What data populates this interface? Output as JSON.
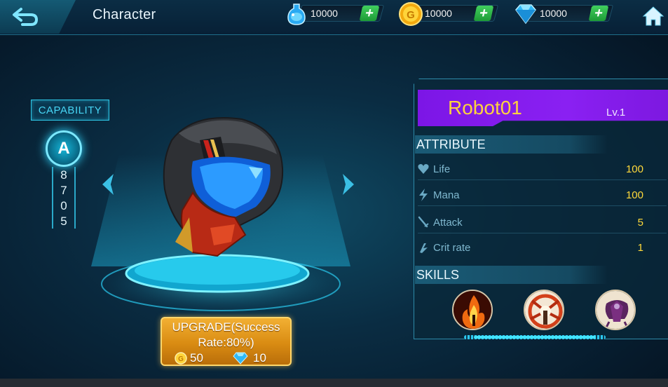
{
  "header": {
    "title": "Character"
  },
  "resources": [
    {
      "name": "mana-potion",
      "value": "10000"
    },
    {
      "name": "gold",
      "value": "10000"
    },
    {
      "name": "diamond",
      "value": "10000"
    }
  ],
  "capability": {
    "label": "CAPABILITY",
    "grade": "A",
    "digits": [
      "8",
      "7",
      "0",
      "5"
    ]
  },
  "upgrade": {
    "label": "UPGRADE(Success Rate:80%)",
    "gold_cost": "50",
    "diamond_cost": "10"
  },
  "character": {
    "name": "Robot01",
    "level": "Lv.1"
  },
  "attributes": {
    "heading": "ATTRIBUTE",
    "items": [
      {
        "label": "Life",
        "value": "100",
        "icon": "heart-icon"
      },
      {
        "label": "Mana",
        "value": "100",
        "icon": "lightning-icon"
      },
      {
        "label": "Attack",
        "value": "5",
        "icon": "sword-icon"
      },
      {
        "label": "Crit rate",
        "value": "1",
        "icon": "crit-icon"
      }
    ]
  },
  "skills": {
    "heading": "SKILLS",
    "items": [
      {
        "name": "fire-skill-icon"
      },
      {
        "name": "burst-skill-icon"
      },
      {
        "name": "dark-skill-icon"
      }
    ]
  },
  "colors": {
    "accent": "#2ec8e8",
    "name_bar": "#8a20f2",
    "name_text": "#ffd23e",
    "value_text": "#ffd93b",
    "upgrade_button": "#d98b12"
  }
}
